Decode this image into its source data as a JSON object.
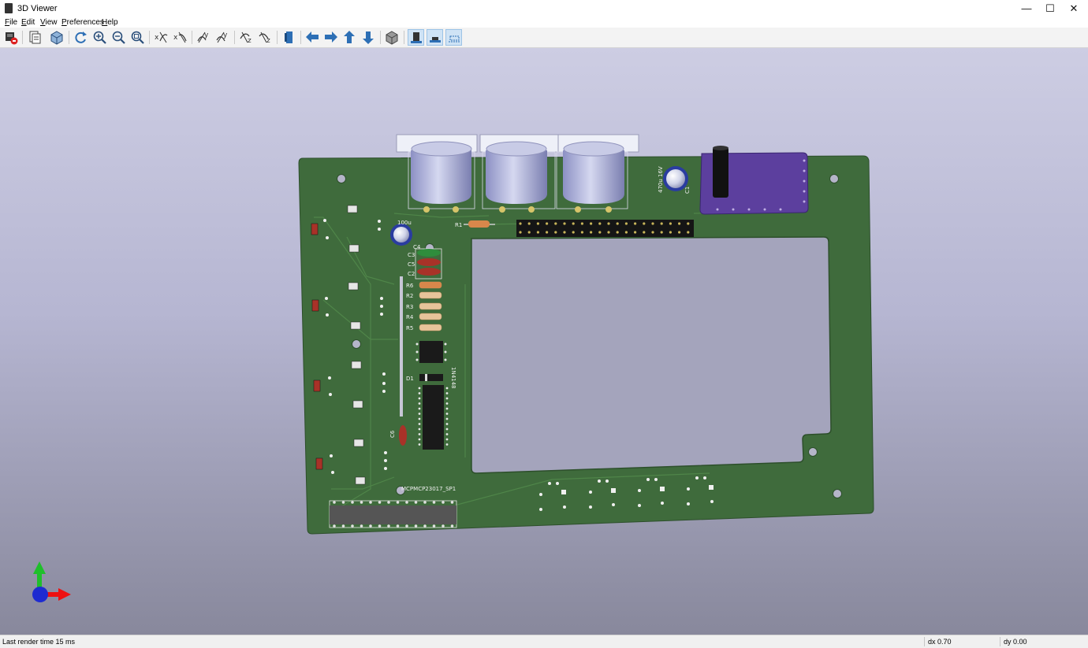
{
  "window": {
    "title": "3D Viewer",
    "controls": {
      "minimize": "—",
      "maximize": "☐",
      "close": "✕"
    }
  },
  "menubar": {
    "items": [
      {
        "label": "File",
        "underline": "F",
        "rest": "ile"
      },
      {
        "label": "Edit",
        "underline": "E",
        "rest": "dit"
      },
      {
        "label": "View",
        "underline": "V",
        "rest": "iew"
      },
      {
        "label": "Preferences",
        "underline": "P",
        "rest": "references"
      },
      {
        "label": "Help",
        "underline": "H",
        "rest": "elp"
      }
    ]
  },
  "toolbar": {
    "buttons": [
      "export-image-icon",
      "copy-to-clipboard-icon",
      "render-mode-icon",
      "reload-icon",
      "zoom-in-icon",
      "zoom-out-icon",
      "zoom-fit-icon",
      "rotate-x-cw-icon",
      "rotate-x-ccw-icon",
      "rotate-y-cw-icon",
      "rotate-y-ccw-icon",
      "rotate-z-cw-icon",
      "rotate-z-ccw-icon",
      "flip-board-icon",
      "move-left-icon",
      "move-right-icon",
      "move-up-icon",
      "move-down-icon",
      "orthographic-icon",
      "show-smd-icon",
      "show-tht-icon",
      "show-virtual-icon"
    ]
  },
  "pcb": {
    "silkscreen": {
      "r1": "R1",
      "r6": "R6",
      "r2": "R2",
      "r3": "R3",
      "r4": "R4",
      "r5": "R5",
      "c3": "C3",
      "c4": "C4",
      "c5": "C5",
      "c2": "C2",
      "c1": "C1",
      "c6": "C6",
      "d1": "D1",
      "diode_part": "1N4148",
      "cap_value_large": "470u 16V",
      "cap_value_small": "100u",
      "ic_ref": "MCPMCP23017_SP1"
    },
    "colors": {
      "board": "#3f6b3c",
      "trace": "#4a7d46",
      "background_top": "#cdcde3",
      "background_bottom": "#88889c",
      "pad_gold": "#c9b55a",
      "module_purple": "#5c3f9e"
    }
  },
  "statusbar": {
    "render_time": "Last render time 15 ms",
    "dx": "dx 0.70",
    "dy": "dy 0.00"
  }
}
